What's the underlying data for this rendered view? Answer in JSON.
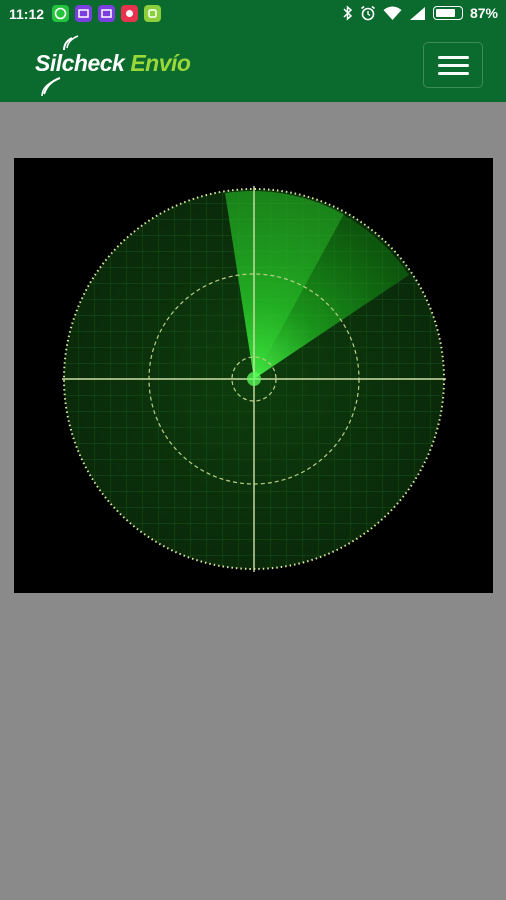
{
  "status_bar": {
    "time": "11:12",
    "battery": "87%",
    "battery_level": 0.87,
    "notification_icons": [
      "whatsapp-icon",
      "message-icon",
      "message-icon",
      "app-icon",
      "android-icon"
    ],
    "system_icons": [
      "bluetooth-icon",
      "alarm-icon",
      "wifi-icon",
      "signal-icon",
      "battery-icon"
    ]
  },
  "header": {
    "brand_primary": "Silcheck",
    "brand_secondary": "Envío",
    "menu_icon": "hamburger-menu-icon"
  },
  "radar": {
    "sweep_color": "#22c722",
    "grid_color": "#0f5a0f"
  },
  "colors": {
    "header_bg": "#0b6a2e",
    "page_bg": "#8a8a8a",
    "brand_accent": "#9ad83a"
  }
}
